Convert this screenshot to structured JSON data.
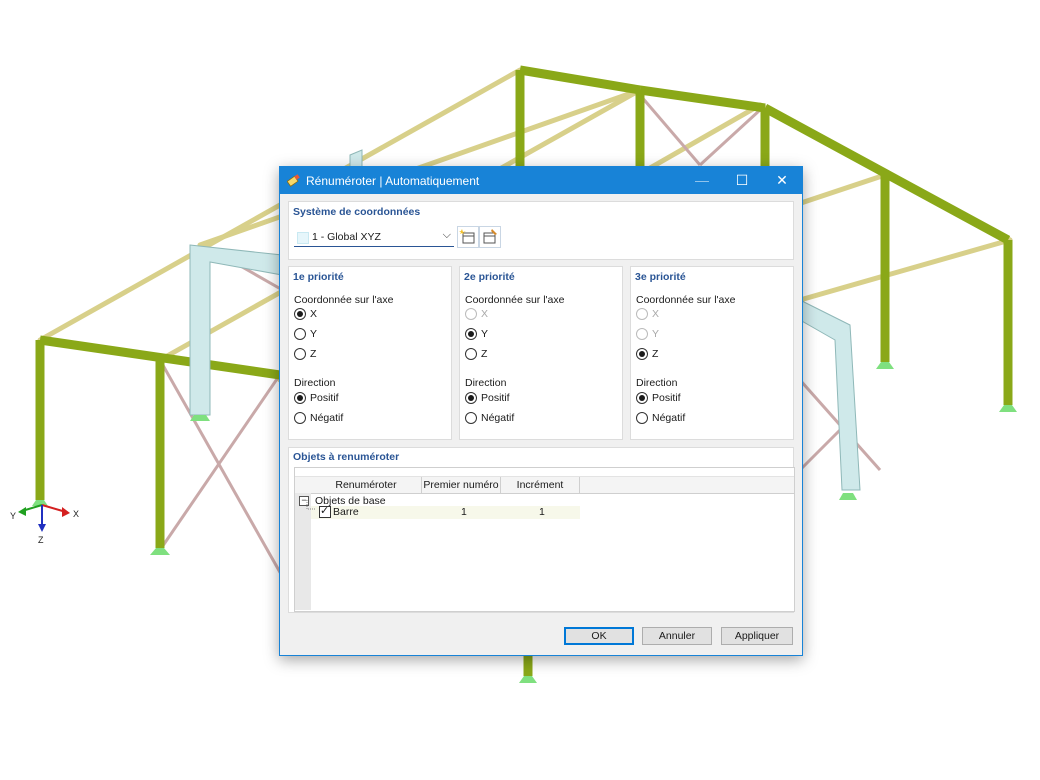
{
  "window": {
    "title": "Rénuméroter | Automatiquement"
  },
  "axes": {
    "x": "X",
    "y": "Y",
    "z": "Z"
  },
  "coord_system": {
    "title": "Système de coordonnées",
    "selected": "1 - Global XYZ"
  },
  "priorities": [
    {
      "title": "1e priorité",
      "axis_label": "Coordonnée sur l'axe",
      "axis_options": [
        {
          "label": "X",
          "checked": true,
          "disabled": false
        },
        {
          "label": "Y",
          "checked": false,
          "disabled": false
        },
        {
          "label": "Z",
          "checked": false,
          "disabled": false
        }
      ],
      "direction_label": "Direction",
      "direction_options": [
        {
          "label": "Positif",
          "checked": true
        },
        {
          "label": "Négatif",
          "checked": false
        }
      ]
    },
    {
      "title": "2e priorité",
      "axis_label": "Coordonnée sur l'axe",
      "axis_options": [
        {
          "label": "X",
          "checked": false,
          "disabled": true
        },
        {
          "label": "Y",
          "checked": true,
          "disabled": false
        },
        {
          "label": "Z",
          "checked": false,
          "disabled": false
        }
      ],
      "direction_label": "Direction",
      "direction_options": [
        {
          "label": "Positif",
          "checked": true
        },
        {
          "label": "Négatif",
          "checked": false
        }
      ]
    },
    {
      "title": "3e priorité",
      "axis_label": "Coordonnée sur l'axe",
      "axis_options": [
        {
          "label": "X",
          "checked": false,
          "disabled": true
        },
        {
          "label": "Y",
          "checked": false,
          "disabled": true
        },
        {
          "label": "Z",
          "checked": true,
          "disabled": false
        }
      ],
      "direction_label": "Direction",
      "direction_options": [
        {
          "label": "Positif",
          "checked": true
        },
        {
          "label": "Négatif",
          "checked": false
        }
      ]
    }
  ],
  "objects": {
    "title": "Objets à renuméroter",
    "columns": [
      "Renuméroter",
      "Premier numéro",
      "Incrément"
    ],
    "group": "Objets de base",
    "item": {
      "label": "Barre",
      "checked": true,
      "first": "1",
      "increment": "1"
    }
  },
  "buttons": {
    "ok": "OK",
    "cancel": "Annuler",
    "apply": "Appliquer"
  },
  "icons": {
    "app": "renumber-icon",
    "new": "new-coordinate-system-icon",
    "edit": "edit-coordinate-system-icon"
  }
}
